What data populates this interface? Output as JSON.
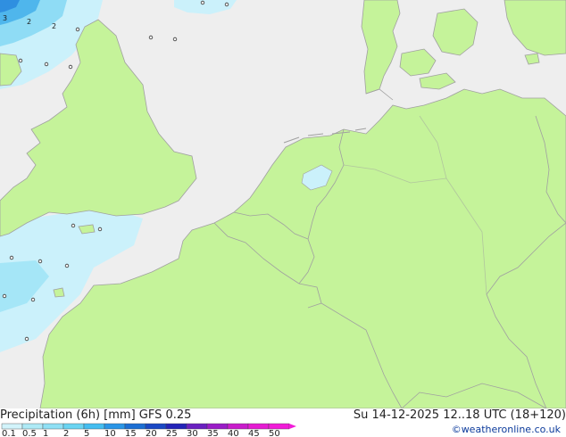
{
  "footer": {
    "title": "Precipitation (6h) [mm] GFS 0.25",
    "datetime": "Su 14-12-2025 12..18 UTC (18+120)",
    "credit": "©weatheronline.co.uk"
  },
  "legend": {
    "labels": [
      "0.1",
      "0.5",
      "1",
      "2",
      "5",
      "10",
      "15",
      "20",
      "25",
      "30",
      "35",
      "40",
      "45",
      "50"
    ],
    "colors": [
      "#d2f4fb",
      "#aeeaf6",
      "#8fe0f5",
      "#6ad4f2",
      "#44bdf0",
      "#2a95e6",
      "#1c6ed3",
      "#1a48c4",
      "#2323b8",
      "#6a20c0",
      "#9a1cc7",
      "#c81ccb",
      "#e51cd2",
      "#f11cd8"
    ]
  },
  "map": {
    "land_color": "#c5f39a",
    "sea_color": "#eeeeee",
    "border_color": "#a0a0a0",
    "precip_colors": {
      "light": "#cbf1fb",
      "medium": "#a5e6f7",
      "heavy": "#5fc4ee",
      "very_heavy": "#2f8fe0"
    },
    "value_labels": [
      "2",
      "3",
      "2"
    ]
  }
}
